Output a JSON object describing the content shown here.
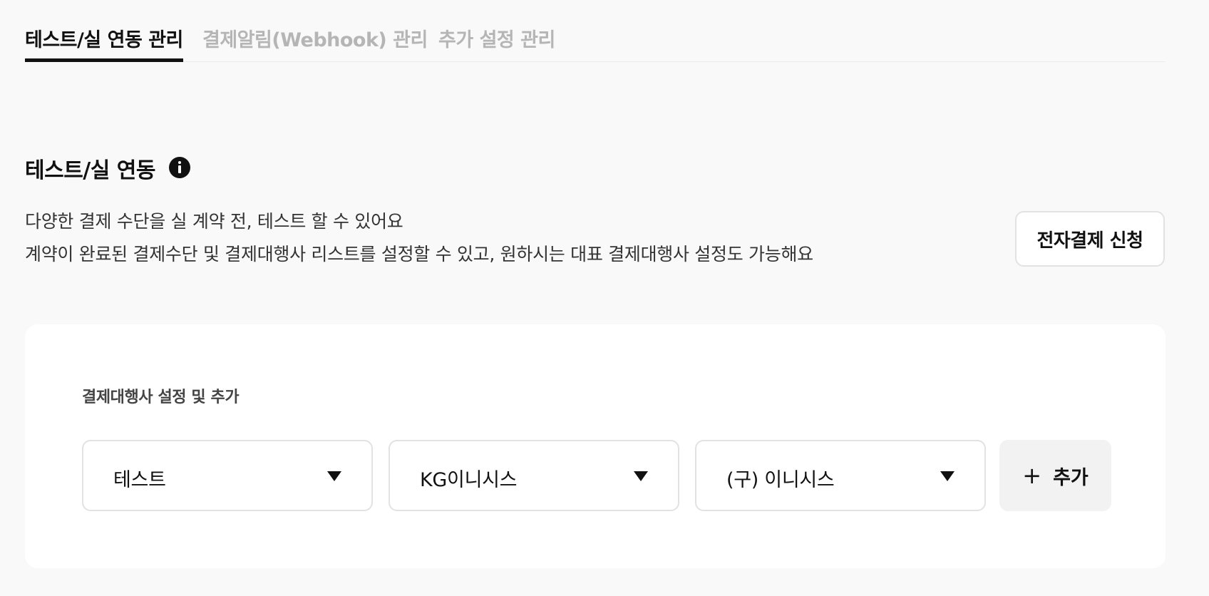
{
  "tabs": [
    {
      "label": "테스트/실 연동 관리",
      "active": true
    },
    {
      "label": "결제알림(Webhook) 관리",
      "active": false
    },
    {
      "label": "추가 설정 관리",
      "active": false
    }
  ],
  "section": {
    "title": "테스트/실 연동",
    "info_icon": "info-icon",
    "description": [
      "다양한 결제 수단을 실 계약 전, 테스트 할 수 있어요",
      "계약이 완료된 결제수단 및 결제대행사 리스트를 설정할 수 있고, 원하시는 대표 결제대행사 설정도 가능해요"
    ],
    "apply_button": "전자결제 신청"
  },
  "pg_settings": {
    "label": "결제대행사 설정 및 추가",
    "selects": [
      {
        "value": "테스트",
        "icon": "caret-down-icon"
      },
      {
        "value": "KG이니시스",
        "icon": "caret-down-icon"
      },
      {
        "value": "(구) 이니시스",
        "icon": "caret-down-icon"
      }
    ],
    "add_button": {
      "icon": "+",
      "label": "추가"
    }
  }
}
